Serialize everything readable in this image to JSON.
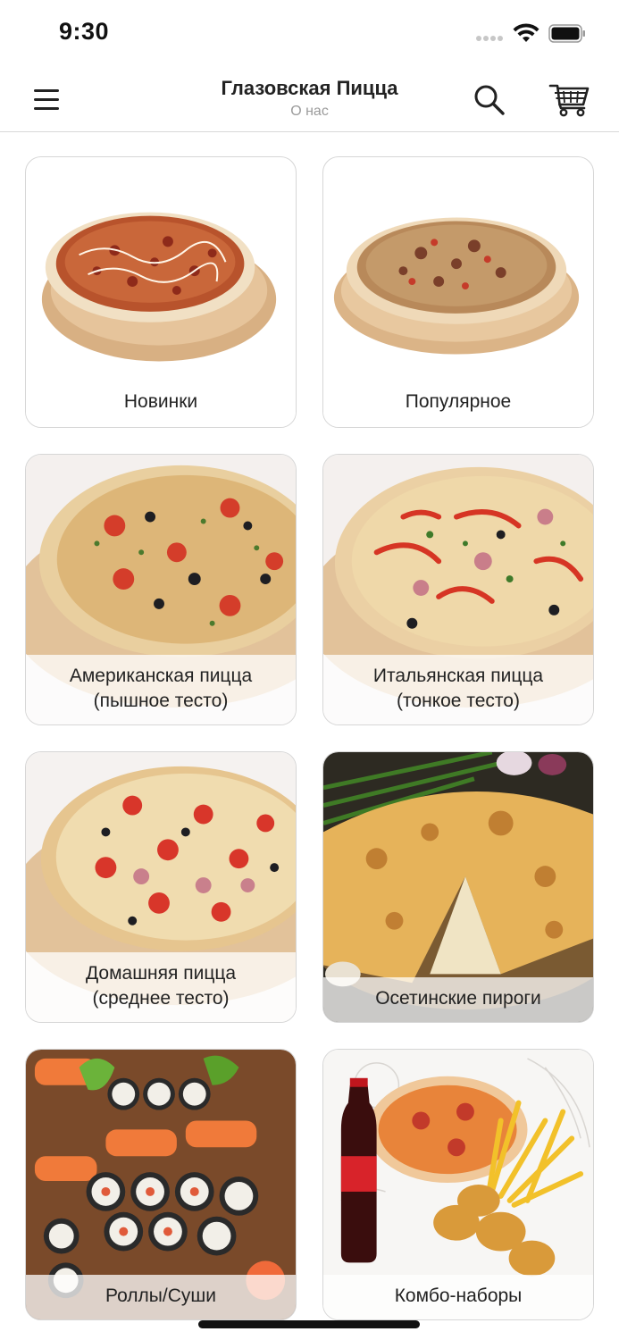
{
  "status_bar": {
    "time": "9:30",
    "icons": [
      "signal-icon",
      "wifi-icon",
      "battery-icon"
    ]
  },
  "nav": {
    "title": "Глазовская Пицца",
    "subtitle": "О нас",
    "icons": [
      "menu-icon",
      "search-icon",
      "cart-icon"
    ]
  },
  "categories": [
    {
      "line1": "Новинки",
      "line2": ""
    },
    {
      "line1": "Популярное",
      "line2": ""
    },
    {
      "line1": "Американская пицца",
      "line2": "(пышное тесто)"
    },
    {
      "line1": "Итальянская пицца",
      "line2": "(тонкое тесто)"
    },
    {
      "line1": "Домашняя пицца",
      "line2": "(среднее тесто)"
    },
    {
      "line1": "Осетинские пироги",
      "line2": ""
    },
    {
      "line1": "Роллы/Суши",
      "line2": ""
    },
    {
      "line1": "Комбо-наборы",
      "line2": ""
    }
  ],
  "colors": {
    "text": "#222222",
    "subtitle": "#9b9b9b",
    "border": "#d6d6d6",
    "background": "#ffffff"
  }
}
